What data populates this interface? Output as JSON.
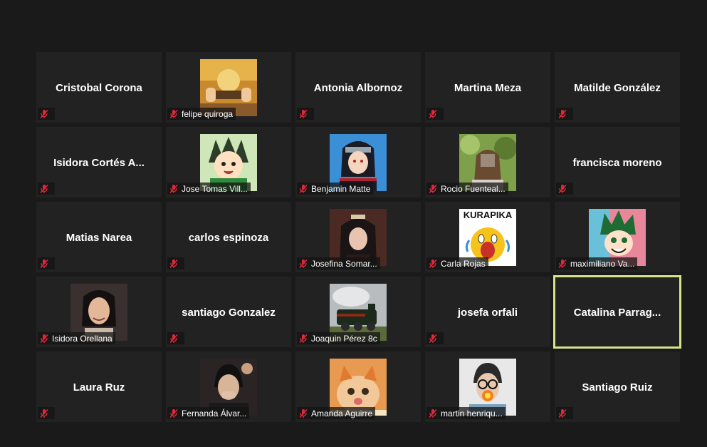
{
  "participants": [
    {
      "name": "Cristobal Corona",
      "has_photo": false
    },
    {
      "name": "felipe quiroga",
      "has_photo": true
    },
    {
      "name": "Antonia Albornoz",
      "has_photo": false
    },
    {
      "name": "Martina Meza",
      "has_photo": false
    },
    {
      "name": "Matilde González",
      "has_photo": false
    },
    {
      "name": "Isidora Cortés A...",
      "has_photo": false
    },
    {
      "name": "Jose Tomas Vill...",
      "has_photo": true
    },
    {
      "name": "Benjamin Matte",
      "has_photo": true
    },
    {
      "name": "Rocio Fuenteal...",
      "has_photo": true
    },
    {
      "name": "francisca moreno",
      "has_photo": false
    },
    {
      "name": "Matias Narea",
      "has_photo": false
    },
    {
      "name": "carlos espinoza",
      "has_photo": false
    },
    {
      "name": "Josefina Somar...",
      "has_photo": true
    },
    {
      "name": "Carla Rojas",
      "has_photo": true
    },
    {
      "name": "maximiliano Va...",
      "has_photo": true
    },
    {
      "name": "Isidora Orellana",
      "has_photo": true
    },
    {
      "name": "santiago Gonzalez",
      "has_photo": false
    },
    {
      "name": "Joaquin Pérez 8c",
      "has_photo": true
    },
    {
      "name": "josefa orfali",
      "has_photo": false
    },
    {
      "name": "Catalina  Parrag...",
      "has_photo": false,
      "active_speaker": true
    },
    {
      "name": "Laura Ruz",
      "has_photo": false
    },
    {
      "name": "Fernanda Álvar...",
      "has_photo": true
    },
    {
      "name": "Amanda Aguirre",
      "has_photo": true
    },
    {
      "name": "martin henriqu...",
      "has_photo": true
    },
    {
      "name": "Santiago Ruiz",
      "has_photo": false
    }
  ],
  "avatar_text": {
    "carla_rojas": "KURAPIKA"
  },
  "mic_status": "muted",
  "colors": {
    "background": "#1a1a1a",
    "tile": "#222222",
    "active_border": "#d4e48c",
    "muted_icon": "#e0283a"
  },
  "icons": {
    "mic": "mic-muted-icon"
  }
}
